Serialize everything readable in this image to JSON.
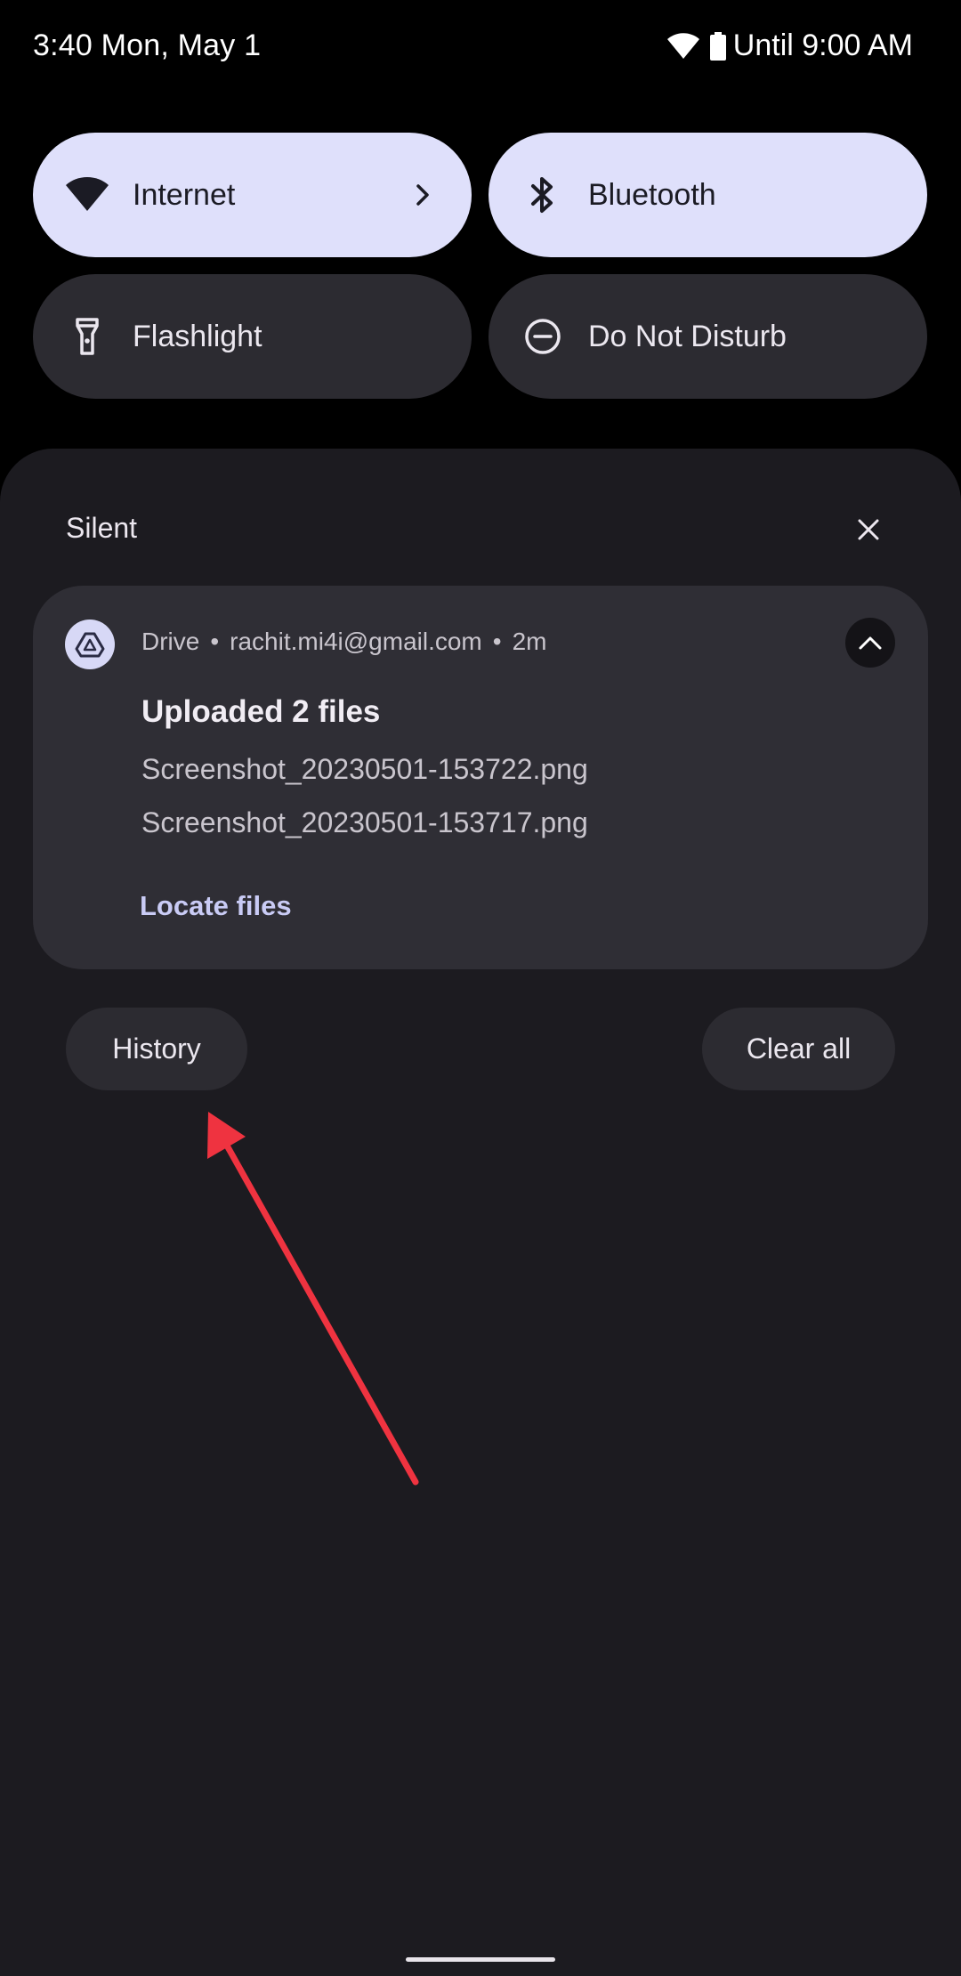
{
  "status_bar": {
    "time_date": "3:40 Mon, May 1",
    "alarm_text": "Until 9:00 AM",
    "icons": [
      "wifi-icon",
      "battery-icon"
    ]
  },
  "quick_settings": {
    "tiles": [
      {
        "label": "Internet",
        "icon": "wifi-icon",
        "active": true,
        "has_chevron": true
      },
      {
        "label": "Bluetooth",
        "icon": "bluetooth-icon",
        "active": true
      },
      {
        "label": "Flashlight",
        "icon": "flashlight-icon",
        "active": false
      },
      {
        "label": "Do Not Disturb",
        "icon": "do-not-disturb-icon",
        "active": false
      }
    ]
  },
  "notifications": {
    "section_label": "Silent",
    "card": {
      "app_name": "Drive",
      "account": "rachit.mi4i@gmail.com",
      "time_ago": "2m",
      "title": "Uploaded 2 files",
      "lines": [
        "Screenshot_20230501-153722.png",
        "Screenshot_20230501-153717.png"
      ],
      "action_label": "Locate files",
      "expanded": true
    },
    "history_label": "History",
    "clear_all_label": "Clear all"
  },
  "colors": {
    "active_tile": "#dfe0fb",
    "inactive_tile": "#2c2b31",
    "shade_background": "#1c1b20",
    "card_background": "#2f2e35",
    "action_text": "#c9cbf5",
    "annotation_arrow": "#ef3340"
  }
}
